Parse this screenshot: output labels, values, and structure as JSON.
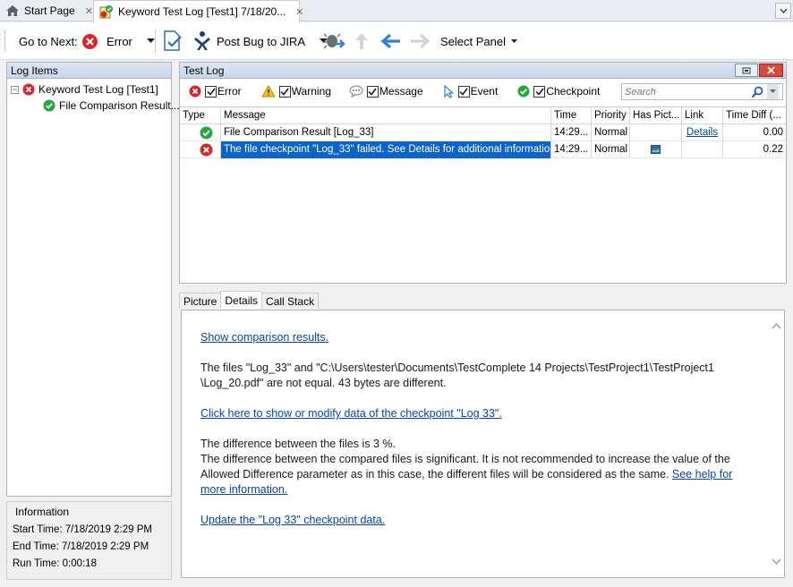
{
  "tabs": [
    {
      "label": "Start Page",
      "close": "✕"
    },
    {
      "label": "Keyword Test Log [Test1] 7/18/20...",
      "close": "✕"
    }
  ],
  "toolbar": {
    "goto_next_label": "Go to Next:",
    "error_label": "Error",
    "post_bug_label": "Post Bug to JIRA",
    "select_panel_label": "Select Panel"
  },
  "log_items": {
    "title": "Log Items",
    "root": "Keyword Test Log [Test1]",
    "child": "File Comparison Result..."
  },
  "info": {
    "title": "Information",
    "start": "Start Time: 7/18/2019 2:29 PM",
    "end": "End Time: 7/18/2019 2:29 PM",
    "run": "Run Time: 0:00:18"
  },
  "test_log": {
    "title": "Test Log",
    "filters": {
      "error": "Error",
      "warning": "Warning",
      "message": "Message",
      "event": "Event",
      "checkpoint": "Checkpoint"
    },
    "search_placeholder": "Search",
    "columns": {
      "type": "Type",
      "message": "Message",
      "time": "Time",
      "priority": "Priority",
      "has_picture": "Has Pict...",
      "link": "Link",
      "time_diff": "Time Diff (..."
    },
    "rows": [
      {
        "message": "File Comparison Result [Log_33]",
        "time": "14:29...",
        "priority": "Normal",
        "link": "Details",
        "time_diff": "0.00"
      },
      {
        "message": "The file checkpoint \"Log_33\" failed. See Details for additional information.",
        "time": "14:29...",
        "priority": "Normal",
        "link": "",
        "time_diff": "0.22"
      }
    ]
  },
  "bottom_tabs": {
    "picture": "Picture",
    "details": "Details",
    "call_stack": "Call Stack"
  },
  "details": {
    "show_results": "Show comparison results.",
    "files_text_1": "The files \"Log_33\" and \"C:\\Users\\tester\\Documents\\TestComplete 14 Projects\\TestProject1\\TestProject1",
    "files_text_2": "\\Log_20.pdf\" are not equal. 43 bytes are different.",
    "modify_link": "Click here to show or modify data of the checkpoint \"Log 33\".",
    "diff_line": "The difference between the files is 3 %.",
    "significant": "The difference between the compared files is significant. It is not recommended to increase the value of the Allowed Difference parameter as in this case, the different files will be considered as the same.",
    "see_help": "See help for more information.",
    "update_link": "Update the \"Log 33\" checkpoint data."
  },
  "colors": {
    "error": "#d7262c",
    "ok": "#25a83a",
    "selection": "#0a64c9",
    "link": "#0645ad",
    "panel_header": "#c7d6ea"
  }
}
